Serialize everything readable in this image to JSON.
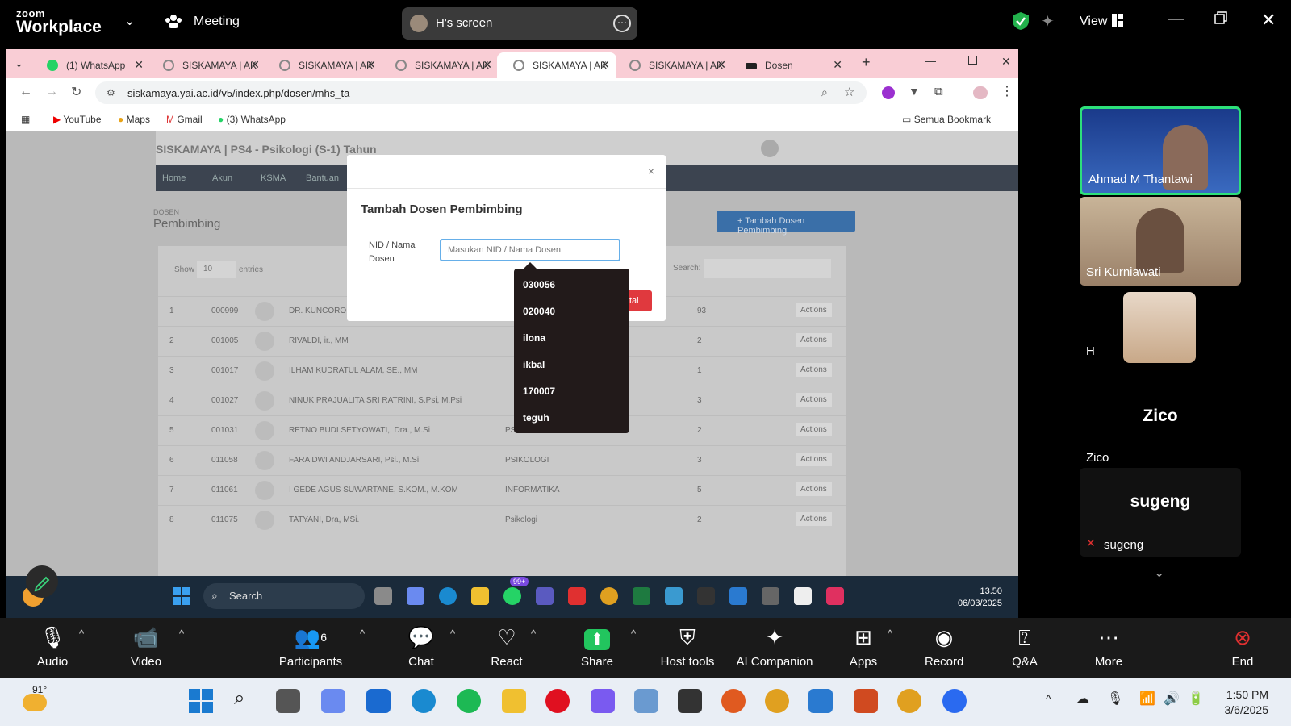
{
  "zoom": {
    "logo_line1": "zoom",
    "logo_line2": "Workplace",
    "meeting_label": "Meeting",
    "screen_label": "H's screen",
    "view_label": "View"
  },
  "browser": {
    "tabs": [
      {
        "label": "(1) WhatsApp"
      },
      {
        "label": "SISKAMAYA | AK"
      },
      {
        "label": "SISKAMAYA | AK"
      },
      {
        "label": "SISKAMAYA | AK"
      },
      {
        "label": "SISKAMAYA | AK"
      },
      {
        "label": "SISKAMAYA | AK"
      },
      {
        "label": "Dosen"
      }
    ],
    "url": "siskamaya.yai.ac.id/v5/index.php/dosen/mhs_ta",
    "bookmarks": [
      "YouTube",
      "Maps",
      "Gmail",
      "(3) WhatsApp"
    ],
    "all_bookmarks": "Semua Bookmark"
  },
  "page": {
    "brand": "SISKAMAYA | PS4 - Psikologi (S-1) Tahun",
    "nav": [
      "Home",
      "Akun",
      "KSMA",
      "Bantuan"
    ],
    "section_small": "DOSEN",
    "section_title": "Pembimbing",
    "add_button": "+ Tambah Dosen Pembimbing",
    "show_label": "Show",
    "entries_value": "10",
    "entries_label": "entries",
    "search_label": "Search:",
    "rows": [
      {
        "no": "1",
        "nid": "000999",
        "name": "DR. KUNCORO TEGUH YUWANTO, S.Psi., M.M",
        "prodi": "",
        "count": "93",
        "action": "Actions"
      },
      {
        "no": "2",
        "nid": "001005",
        "name": "RIVALDI, ir., MM",
        "prodi": "",
        "count": "2",
        "action": "Actions"
      },
      {
        "no": "3",
        "nid": "001017",
        "name": "ILHAM KUDRATUL ALAM, SE., MM",
        "prodi": "",
        "count": "1",
        "action": "Actions"
      },
      {
        "no": "4",
        "nid": "001027",
        "name": "NINUK PRAJUALITA SRI RATRINI, S.Psi, M.Psi",
        "prodi": "",
        "count": "3",
        "action": "Actions"
      },
      {
        "no": "5",
        "nid": "001031",
        "name": "RETNO BUDI SETYOWATI,, Dra., M.Si",
        "prodi": "PSIKOLOGI",
        "count": "2",
        "action": "Actions"
      },
      {
        "no": "6",
        "nid": "011058",
        "name": "FARA DWI ANDJARSARI, Psi., M.Si",
        "prodi": "PSIKOLOGI",
        "count": "3",
        "action": "Actions"
      },
      {
        "no": "7",
        "nid": "011061",
        "name": "I GEDE AGUS SUWARTANE, S.KOM., M.KOM",
        "prodi": "INFORMATIKA",
        "count": "5",
        "action": "Actions"
      },
      {
        "no": "8",
        "nid": "011075",
        "name": "TATYANI, Dra, MSi.",
        "prodi": "Psikologi",
        "count": "2",
        "action": "Actions"
      }
    ]
  },
  "modal": {
    "close": "×",
    "title": "Tambah Dosen Pembimbing",
    "field_label": "NID / Nama Dosen",
    "input_placeholder": "Masukan NID / Nama Dosen",
    "save_button": "tal",
    "suggestions": [
      "030056",
      "020040",
      "ilona",
      "ikbal",
      "170007",
      "teguh"
    ]
  },
  "shared_taskbar": {
    "search": "Search",
    "badge": "99+",
    "time": "13.50",
    "date": "06/03/2025"
  },
  "participants": [
    {
      "name": "Ahmad M Thantawi"
    },
    {
      "name": "Sri Kurniawati"
    },
    {
      "name": "H"
    },
    {
      "name": "Zico",
      "big": "Zico"
    },
    {
      "name": "sugeng",
      "big": "sugeng"
    }
  ],
  "toolbar": {
    "audio": "Audio",
    "video": "Video",
    "participants": "Participants",
    "participants_count": "6",
    "chat": "Chat",
    "react": "React",
    "share": "Share",
    "host_tools": "Host tools",
    "ai_companion": "AI Companion",
    "apps": "Apps",
    "record": "Record",
    "qa": "Q&A",
    "more": "More",
    "end": "End"
  },
  "windows": {
    "temp": "91°",
    "time": "1:50 PM",
    "date": "3/6/2025"
  }
}
